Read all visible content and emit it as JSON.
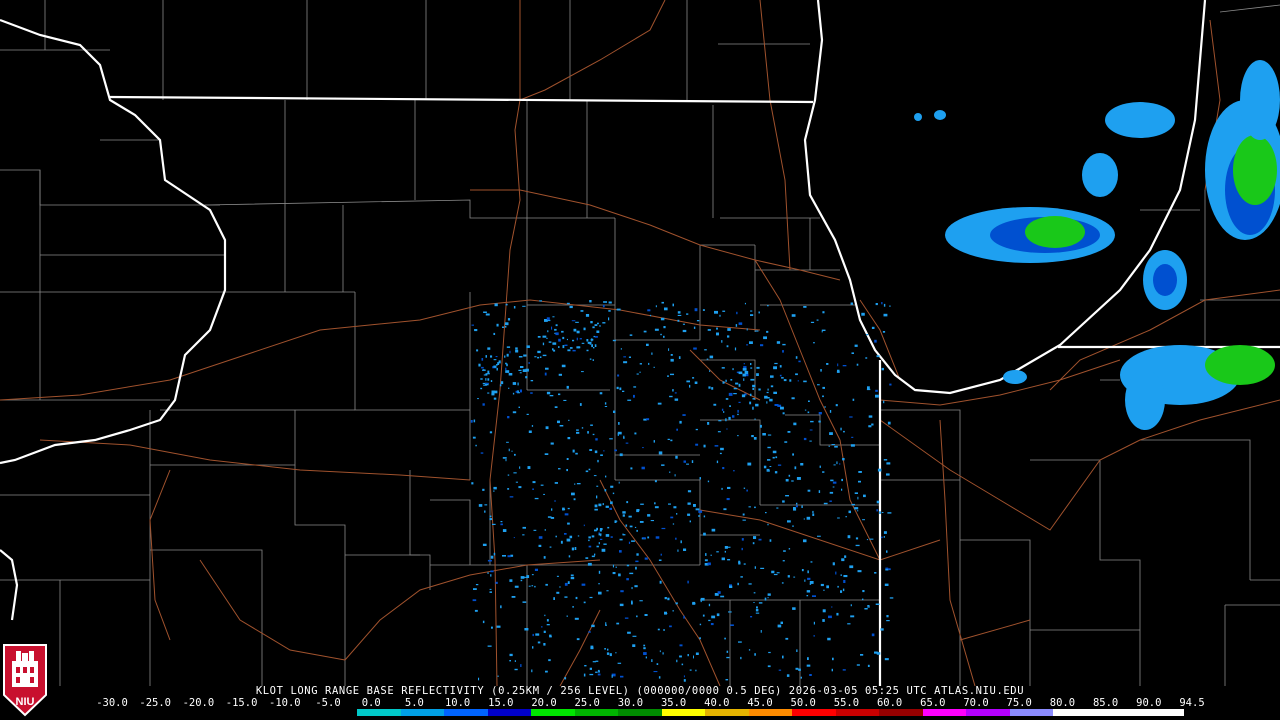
{
  "caption": "KLOT LONG RANGE BASE REFLECTIVITY (0.25KM / 256 LEVEL) (000000/0000 0.5 DEG) 2026-03-05 05:25 UTC  ATLAS.NIU.EDU",
  "logo": {
    "text": "NIU",
    "icon": "niu-logo-icon",
    "color": "#c8102e"
  },
  "colorbar": {
    "ticks": [
      "-30.0",
      "-25.0",
      "-20.0",
      "-15.0",
      "-10.0",
      "-5.0",
      "0.0",
      "5.0",
      "10.0",
      "15.0",
      "20.0",
      "25.0",
      "30.0",
      "35.0",
      "40.0",
      "45.0",
      "50.0",
      "55.0",
      "60.0",
      "65.0",
      "70.0",
      "75.0",
      "80.0",
      "85.0",
      "90.0",
      "94.5"
    ],
    "colors": [
      "#000000",
      "#000000",
      "#000000",
      "#000000",
      "#000000",
      "#000000",
      "#00c8c8",
      "#00a0e6",
      "#0064ff",
      "#0000c8",
      "#00e600",
      "#00b400",
      "#008c00",
      "#ffff00",
      "#e6b400",
      "#ff8c00",
      "#ff0000",
      "#c80000",
      "#960000",
      "#ff00ff",
      "#b400ff",
      "#8c8cff",
      "#ffffff",
      "#ffffff",
      "#ffffff"
    ]
  },
  "map_colors": {
    "state_border": "#ffffff",
    "county_line": "#8a8a8a",
    "road": "#a0522d",
    "echo_light": "#1ea0f0",
    "echo_mid": "#0050d0",
    "echo_heavy": "#19c819"
  }
}
